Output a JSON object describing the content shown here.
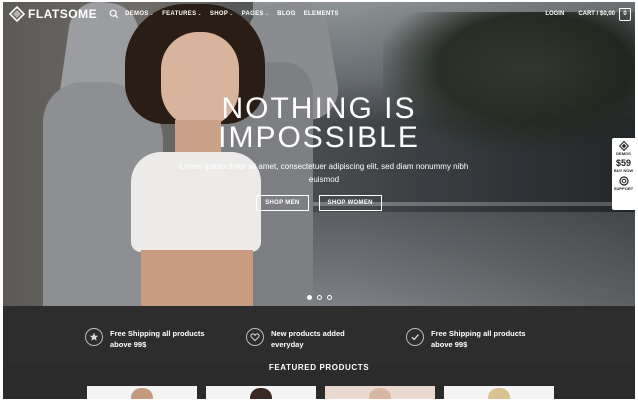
{
  "header": {
    "logo_text": "FLATSOME",
    "nav": [
      {
        "label": "DEMOS",
        "dropdown": true
      },
      {
        "label": "FEATURES",
        "dropdown": true
      },
      {
        "label": "SHOP",
        "dropdown": true
      },
      {
        "label": "PAGES",
        "dropdown": true
      },
      {
        "label": "BLOG",
        "dropdown": false
      },
      {
        "label": "ELEMENTS",
        "dropdown": false
      }
    ],
    "login": "LOGIN",
    "cart_label": "CART / $0,00",
    "cart_count": "0"
  },
  "hero": {
    "headline_line1": "NOTHING IS",
    "headline_line2": "IMPOSSIBLE",
    "lead": "Lorem ipsum dolor sit amet, consectetuer adipiscing elit, sed diam nonummy nibh euismod",
    "buttons": [
      "SHOP MEN",
      "SHOP WOMEN"
    ],
    "slide_count": 3,
    "active_slide": 1
  },
  "side_panel": {
    "demos_label": "DEMOS",
    "price": "$59",
    "buy_label": "BUY NOW",
    "support_label": "SUPPORT"
  },
  "features": [
    {
      "icon": "star-icon",
      "line1": "Free Shipping all products",
      "line2": "above 99$"
    },
    {
      "icon": "heart-icon",
      "line1": "New products added",
      "line2": "everyday"
    },
    {
      "icon": "check-icon",
      "line1": "Free Shipping all products",
      "line2": "above 99$"
    }
  ],
  "featured_title": "FEATURED PRODUCTS",
  "colors": {
    "dark_bar": "#2d2d2d",
    "white": "#ffffff"
  }
}
